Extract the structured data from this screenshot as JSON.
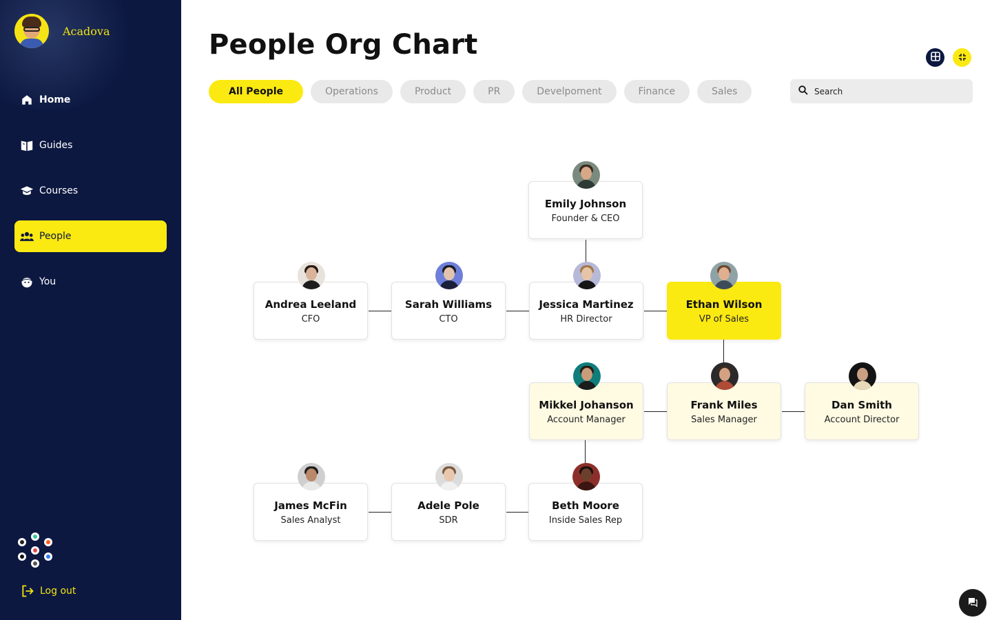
{
  "brand": {
    "name": "Acadova"
  },
  "sidebar": {
    "items": [
      {
        "label": "Home",
        "icon": "home-icon"
      },
      {
        "label": "Guides",
        "icon": "book-icon"
      },
      {
        "label": "Courses",
        "icon": "graduation-cap-icon"
      },
      {
        "label": "People",
        "icon": "people-icon"
      },
      {
        "label": "You",
        "icon": "avatar-face-icon"
      }
    ],
    "active": "People",
    "integration_icons": [
      "github-icon",
      "slack-icon",
      "zapier-icon",
      "google-icon",
      "notion-icon",
      "aws-icon",
      "confluence-icon"
    ],
    "logout_label": "Log out"
  },
  "page": {
    "title": "People Org Chart",
    "view_buttons": [
      "grid-view-icon",
      "collapse-icon"
    ]
  },
  "filters": {
    "active": "All People",
    "items": [
      "All People",
      "Operations",
      "Product",
      "PR",
      "Develpoment",
      "Finance",
      "Sales"
    ]
  },
  "search": {
    "placeholder": "Search"
  },
  "people": [
    {
      "name": "Emily Johnson",
      "role": "Founder & CEO"
    },
    {
      "name": "Andrea Leeland",
      "role": "CFO"
    },
    {
      "name": "Sarah Williams",
      "role": "CTO"
    },
    {
      "name": "Jessica Martinez",
      "role": "HR Director"
    },
    {
      "name": "Ethan Wilson",
      "role": "VP of Sales"
    },
    {
      "name": "Mikkel Johanson",
      "role": "Account Manager"
    },
    {
      "name": "Frank Miles",
      "role": "Sales Manager"
    },
    {
      "name": "Dan Smith",
      "role": "Account Director"
    },
    {
      "name": "James McFin",
      "role": "Sales Analyst"
    },
    {
      "name": "Adele Pole",
      "role": "SDR"
    },
    {
      "name": "Beth Moore",
      "role": "Inside Sales Rep"
    }
  ],
  "selected_person": "Ethan Wilson",
  "colors": {
    "sidebar": "#0c1840",
    "accent": "#fbe912",
    "team_card": "#fffbe3"
  },
  "chat": {
    "icon": "chat-icon"
  }
}
